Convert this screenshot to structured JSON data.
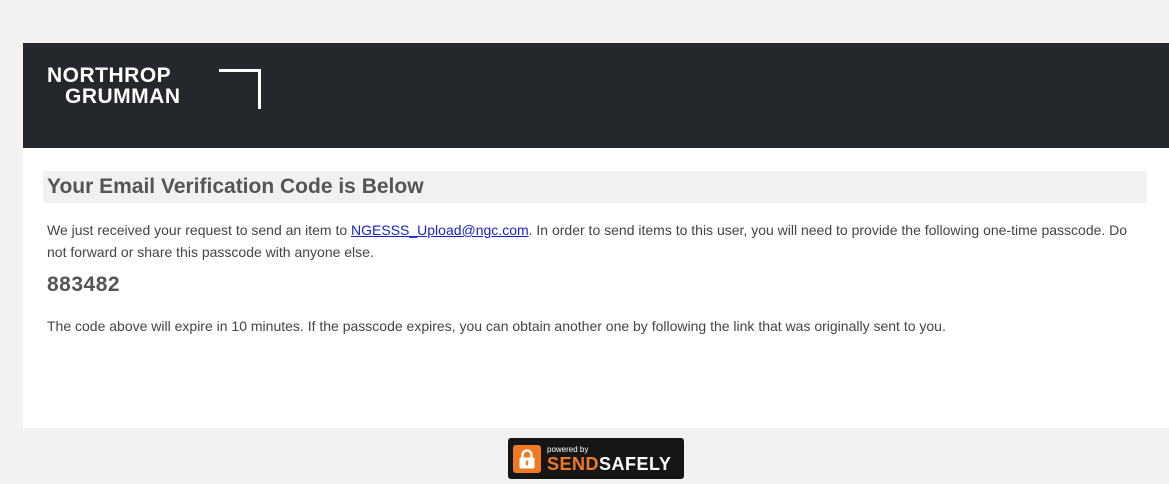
{
  "header": {
    "logo": {
      "line1": "NORTHROP",
      "line2": "GRUMMAN",
      "text_color": "#ffffff",
      "bar_color": "#24272b"
    }
  },
  "main": {
    "title": "Your Email Verification Code is Below",
    "intro": {
      "before_link": "We just received your request to send an item to ",
      "link_text": "NGESSS_Upload@ngc.com",
      "after_link": ". In order to send items to this user, you will need to provide the following one-time passcode. Do not forward or share this passcode with anyone else."
    },
    "passcode": "883482",
    "expiry_text": "The code above will expire in 10 minutes. If the passcode expires, you can obtain another one by following the link that was originally sent to you."
  },
  "footer": {
    "powered_by": "powered by",
    "brand_part1": "SEND",
    "brand_part2": "SAFELY",
    "icon": "lock-icon",
    "accent_color": "#f07a22"
  },
  "colors": {
    "page_background": "#f2f2f2",
    "link": "#1a22c9",
    "heading": "#555555",
    "body_text": "#444444"
  }
}
